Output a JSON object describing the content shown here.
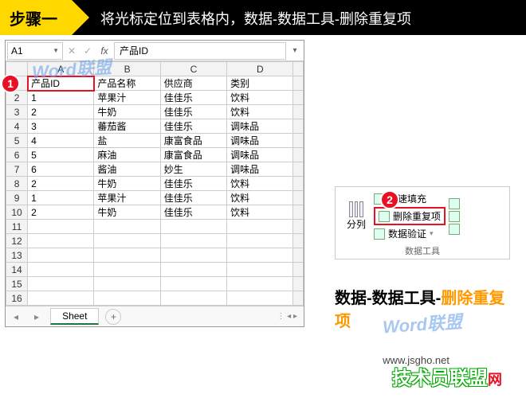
{
  "header": {
    "step": "步骤一",
    "desc": "将光标定位到表格内，数据-数据工具-删除重复项"
  },
  "namebox": {
    "cell": "A1",
    "formula_value": "产品ID"
  },
  "columns": [
    "A",
    "B",
    "C",
    "D"
  ],
  "headers": [
    "产品ID",
    "产品名称",
    "供应商",
    "类别"
  ],
  "rows": [
    {
      "n": 1,
      "c": [
        "产品ID",
        "产品名称",
        "供应商",
        "类别"
      ]
    },
    {
      "n": 2,
      "c": [
        "1",
        "苹果汁",
        "佳佳乐",
        "饮料"
      ]
    },
    {
      "n": 3,
      "c": [
        "2",
        "牛奶",
        "佳佳乐",
        "饮料"
      ]
    },
    {
      "n": 4,
      "c": [
        "3",
        "蕃茄酱",
        "佳佳乐",
        "调味品"
      ]
    },
    {
      "n": 5,
      "c": [
        "4",
        "盐",
        "康富食品",
        "调味品"
      ]
    },
    {
      "n": 6,
      "c": [
        "5",
        "麻油",
        "康富食品",
        "调味品"
      ]
    },
    {
      "n": 7,
      "c": [
        "6",
        "酱油",
        "妙生",
        "调味品"
      ]
    },
    {
      "n": 8,
      "c": [
        "2",
        "牛奶",
        "佳佳乐",
        "饮料"
      ]
    },
    {
      "n": 9,
      "c": [
        "1",
        "苹果汁",
        "佳佳乐",
        "饮料"
      ]
    },
    {
      "n": 10,
      "c": [
        "2",
        "牛奶",
        "佳佳乐",
        "饮料"
      ]
    },
    {
      "n": 11,
      "c": [
        "",
        "",
        "",
        ""
      ]
    },
    {
      "n": 12,
      "c": [
        "",
        "",
        "",
        ""
      ]
    },
    {
      "n": 13,
      "c": [
        "",
        "",
        "",
        ""
      ]
    },
    {
      "n": 14,
      "c": [
        "",
        "",
        "",
        ""
      ]
    },
    {
      "n": 15,
      "c": [
        "",
        "",
        "",
        ""
      ]
    },
    {
      "n": 16,
      "c": [
        "",
        "",
        "",
        ""
      ]
    }
  ],
  "sheet": {
    "name": "Sheet"
  },
  "ribbon": {
    "split_columns": "分列",
    "flash_fill": "快速填充",
    "remove_duplicates": "删除重复项",
    "data_validation": "数据验证",
    "group_label": "数据工具"
  },
  "breadcrumb": {
    "p1": "数据",
    "p2": "数据工具",
    "p3": "删除重复项"
  },
  "badges": {
    "one": "1",
    "two": "2"
  },
  "watermark": "Word联盟",
  "footer": {
    "logo": "技术员联盟",
    "ext": "网",
    "url": "www.jsgho.net"
  }
}
